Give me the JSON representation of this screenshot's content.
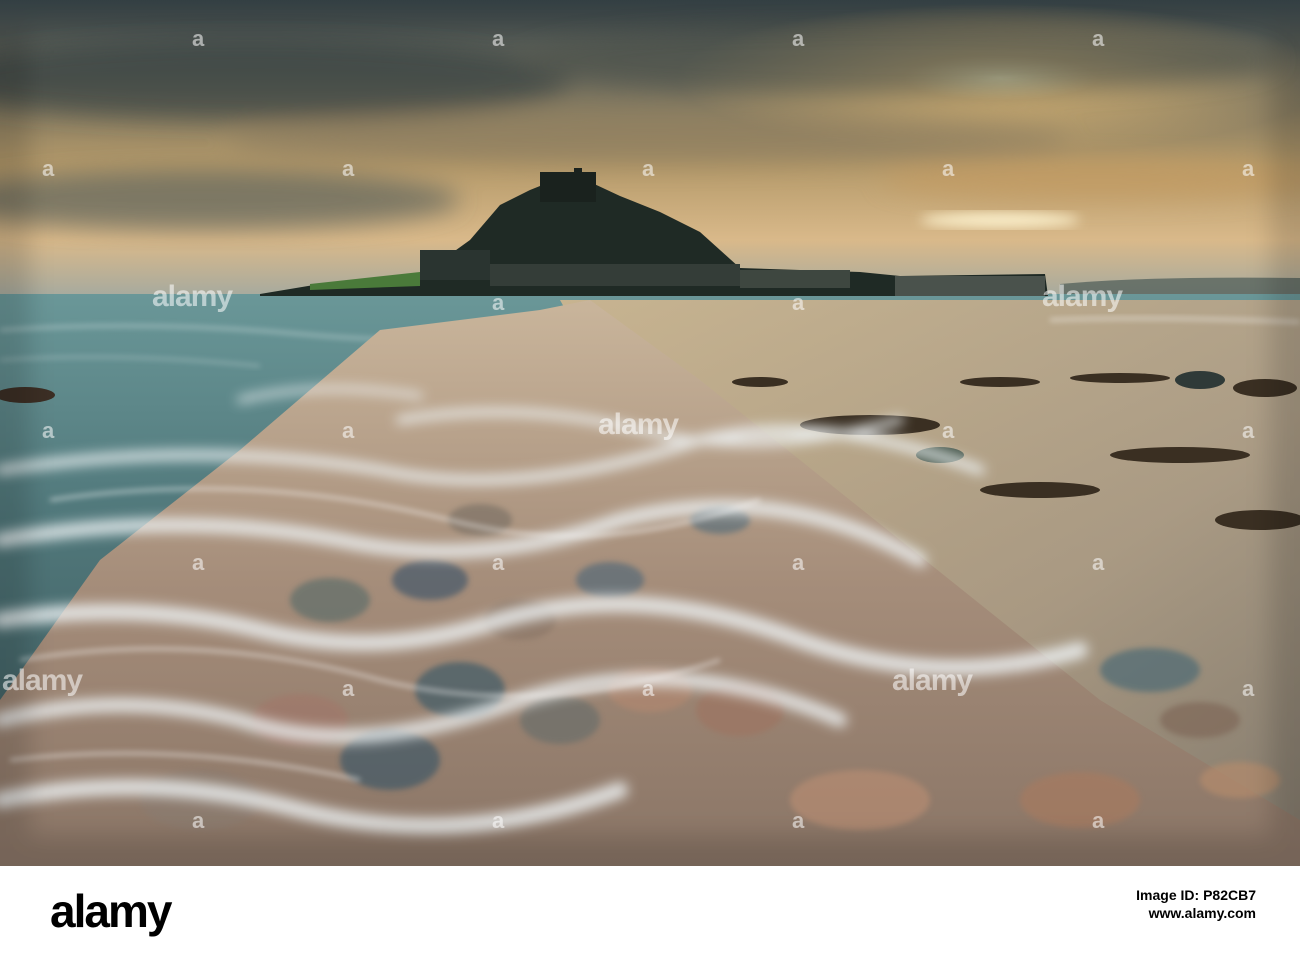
{
  "photo": {
    "subject": "",
    "colors": {
      "sky_top": "#3f4e52",
      "sky_glow": "#f0c27a",
      "sea": "#5f8f92",
      "causeway": "#b7a08a",
      "foam": "#e9eef0",
      "silhouette": "#1b2420"
    }
  },
  "watermark": {
    "logo": "alamy",
    "dot": "a"
  },
  "footer": {
    "logo": "alamy",
    "image_id": "Image ID: P82CB7",
    "url": "www.alamy.com"
  }
}
